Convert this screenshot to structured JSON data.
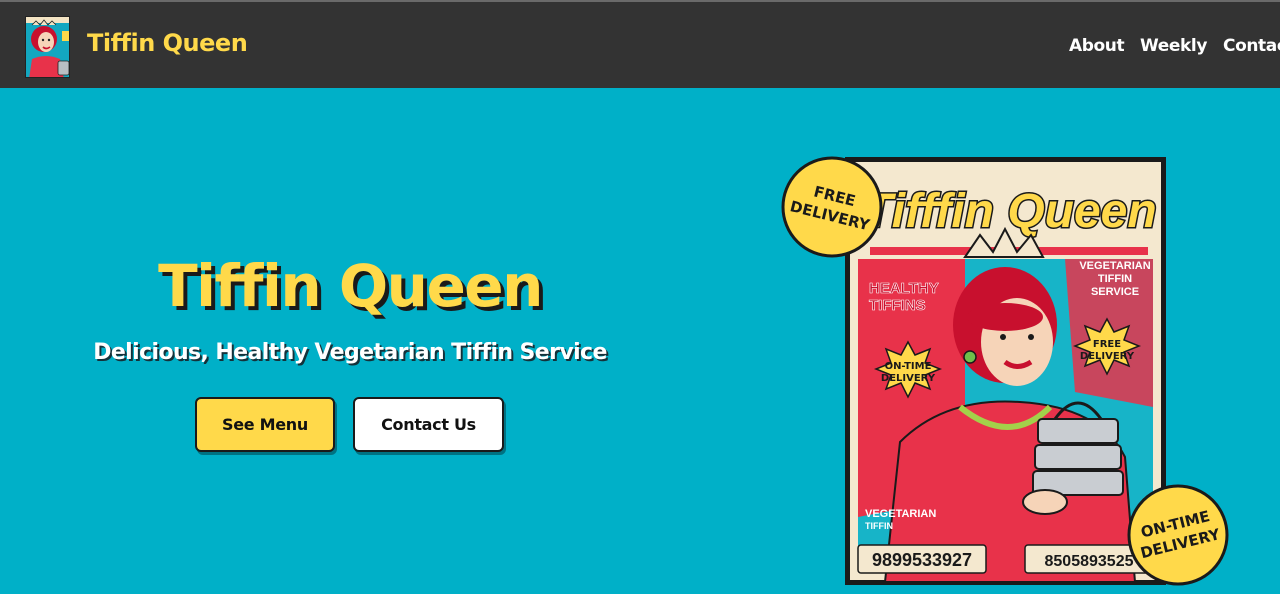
{
  "header": {
    "brand": "Tiffin Queen",
    "nav": {
      "about": "About",
      "weekly": "Weekly",
      "contact": "Contac"
    }
  },
  "hero": {
    "title": "Tiffin Queen",
    "subtitle": "Delicious, Healthy Vegetarian Tiffin Service",
    "see_menu": "See Menu",
    "contact_us": "Contact Us"
  },
  "poster": {
    "title": "Tifffin Queen",
    "left_headline_1": "HEALTHY",
    "left_headline_2": "TIFFINS",
    "right_headline_1": "VEGETARIAN",
    "right_headline_2": "TIFFIN",
    "right_headline_3": "SERVICE",
    "burst_left_1": "ON-TIME",
    "burst_left_2": "DELIVERY",
    "burst_right_1": "FREE",
    "burst_right_2": "DELIVERY",
    "bottom_left_1": "VEGETARIAN",
    "bottom_left_2": "TIFFIN",
    "phone_1": "9899533927",
    "phone_2": "8505893525",
    "badge_top_1": "FREE",
    "badge_top_2": "DELIVERY",
    "badge_bottom_1": "ON-TIME",
    "badge_bottom_2": "DELIVERY"
  },
  "colors": {
    "header_bg": "#333333",
    "hero_bg": "#00b0c8",
    "accent_yellow": "#ffd94a",
    "poster_red": "#e8324a"
  }
}
